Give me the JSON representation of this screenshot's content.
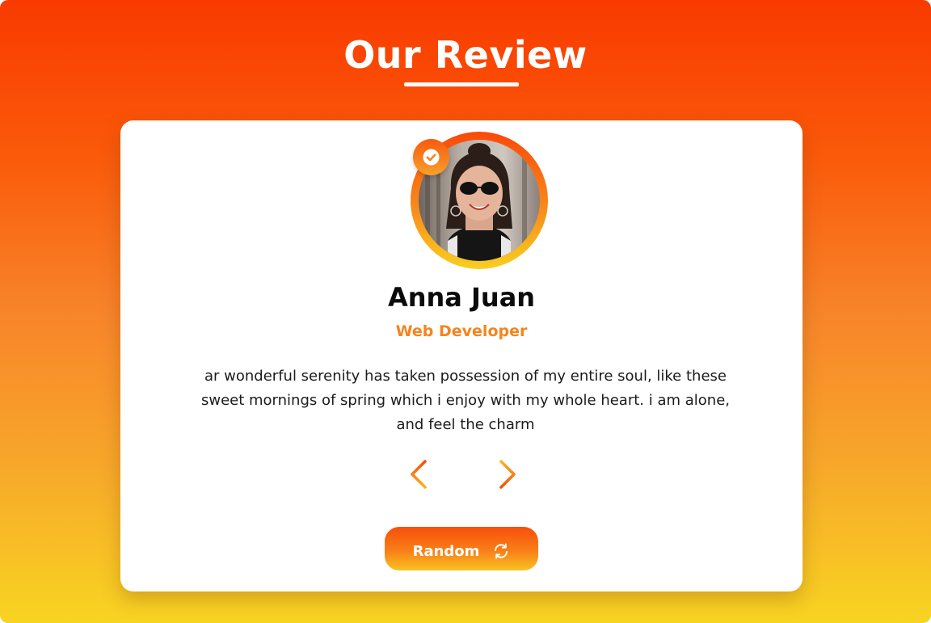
{
  "header": {
    "title": "Our  Review"
  },
  "review": {
    "name": "Anna Juan",
    "role": "Web Developer",
    "quote": "ar wonderful serenity has taken possession of my entire soul, like these sweet mornings of spring which i enjoy with my whole heart. i am alone, and feel the charm"
  },
  "controls": {
    "random_label": "Random",
    "prev_icon": "chevron-left-icon",
    "next_icon": "chevron-right-icon",
    "random_icon": "refresh-icon",
    "verified_icon": "check-circle-icon"
  },
  "colors": {
    "accent_orange": "#f5841c",
    "gradient_top": "#f93a00",
    "gradient_bottom": "#f8d422"
  }
}
